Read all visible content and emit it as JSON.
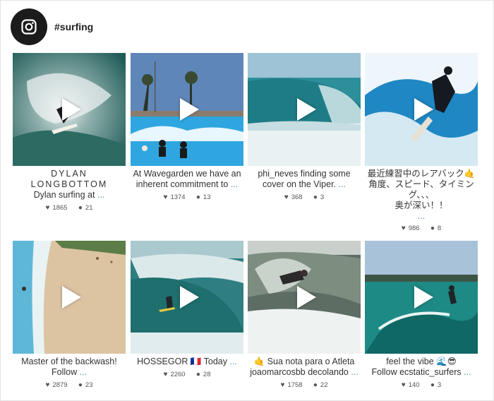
{
  "header": {
    "hashtag": "#surfing",
    "logo_icon": "instagram-icon"
  },
  "posts": [
    {
      "caption_line1": "DYLAN",
      "caption_line2": "LONGBOTTOM",
      "caption_line3": "Dylan surfing at",
      "more": "...",
      "likes": "1865",
      "comments": "21"
    },
    {
      "caption_line1": "At Wavegarden we have an",
      "caption_line2": "inherent commitment to",
      "more": "...",
      "likes": "1374",
      "comments": "13"
    },
    {
      "caption_line1": "phi_neves finding some",
      "caption_line2": "cover on the Viper.",
      "more": "...",
      "likes": "368",
      "comments": "3"
    },
    {
      "caption_line1": "最近練習中のレアバック🤙",
      "caption_line2": "角度、スピード、タイミング、、、",
      "caption_line3": "奥が深い！！",
      "more": "...",
      "likes": "986",
      "comments": "8"
    },
    {
      "caption_line1": "Master of the backwash!",
      "caption_line2": "Follow",
      "more": "...",
      "likes": "2879",
      "comments": "23"
    },
    {
      "caption_line1": "HOSSEGOR 🇫🇷 Today",
      "more": "...",
      "likes": "2260",
      "comments": "28"
    },
    {
      "caption_line1": "🤙 Sua nota para o Atleta",
      "caption_line2": "joaomarcosbb decolando",
      "more": "...",
      "likes": "1758",
      "comments": "22"
    },
    {
      "caption_line1": "feel the vibe 🌊😎",
      "caption_line2": "Follow ecstatic_surfers",
      "more": "...",
      "likes": "140",
      "comments": "3"
    }
  ]
}
